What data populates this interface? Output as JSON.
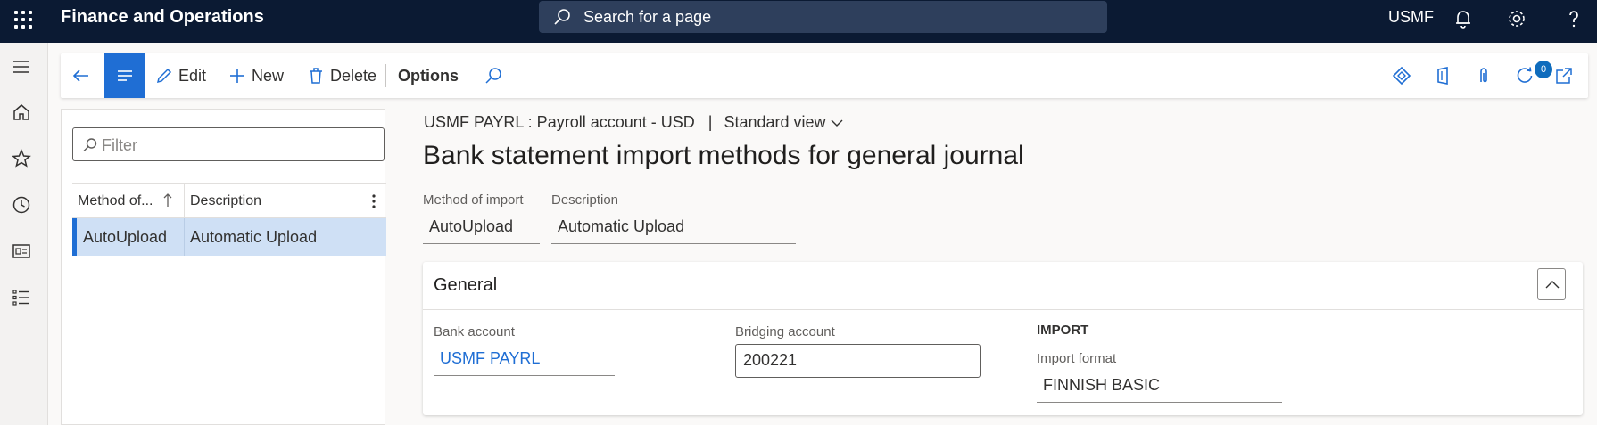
{
  "app": {
    "title": "Finance and Operations",
    "company": "USMF"
  },
  "search": {
    "placeholder": "Search for a page"
  },
  "toolbar": {
    "edit": "Edit",
    "new": "New",
    "delete": "Delete",
    "options": "Options",
    "badge_count": "0"
  },
  "list": {
    "filter_placeholder": "Filter",
    "columns": [
      "Method of...",
      "Description"
    ],
    "rows": [
      {
        "method": "AutoUpload",
        "description": "Automatic Upload"
      }
    ]
  },
  "form": {
    "caption": "USMF PAYRL : Payroll account - USD",
    "separator": "|",
    "view": "Standard view",
    "title": "Bank statement import methods for general journal",
    "method_label": "Method of import",
    "method_value": "AutoUpload",
    "description_label": "Description",
    "description_value": "Automatic Upload"
  },
  "general": {
    "title": "General",
    "bank_account_label": "Bank account",
    "bank_account_value": "USMF PAYRL",
    "bridging_account_label": "Bridging account",
    "bridging_account_value": "200221",
    "import_group": "IMPORT",
    "import_format_label": "Import format",
    "import_format_value": "FINNISH BASIC"
  },
  "colors": {
    "topbar": "#0b1a33",
    "accent": "#1f6ed4",
    "selected_row": "#cfe0f5"
  }
}
